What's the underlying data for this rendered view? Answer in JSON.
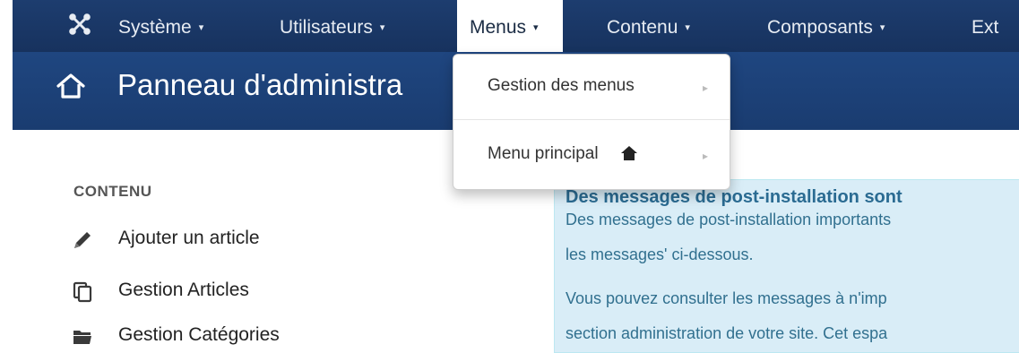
{
  "topnav": {
    "logo_icon": "joomla-logo-icon",
    "items": [
      {
        "label": "Système"
      },
      {
        "label": "Utilisateurs"
      },
      {
        "label": "Menus"
      },
      {
        "label": "Contenu"
      },
      {
        "label": "Composants"
      },
      {
        "label": "Ext"
      }
    ],
    "caret": "▾"
  },
  "header": {
    "home_icon": "home-icon",
    "title": "Panneau d'administra"
  },
  "dropdown": {
    "items": [
      {
        "label": "Gestion des menus",
        "submenu_arrow": "▸"
      },
      {
        "label": "Menu principal",
        "home_badge": "home-icon",
        "submenu_arrow": "▸"
      }
    ]
  },
  "sidebar": {
    "section_title": "CONTENU",
    "items": [
      {
        "label": "Ajouter un article",
        "icon": "pencil-icon"
      },
      {
        "label": "Gestion Articles",
        "icon": "copy-icon"
      },
      {
        "label": "Gestion Catégories",
        "icon": "folder-icon"
      }
    ]
  },
  "alert": {
    "title": "Des messages de post-installation sont",
    "lines": [
      "Des messages de post-installation importants",
      "les messages' ci-dessous.",
      "Vous pouvez consulter les messages à n'imp",
      "section administration de votre site. Cet espa"
    ]
  },
  "colors": {
    "topbar": "#1a3867",
    "header": "#1f4680",
    "alert_bg": "#d9edf7",
    "alert_title": "#2a6b92"
  }
}
